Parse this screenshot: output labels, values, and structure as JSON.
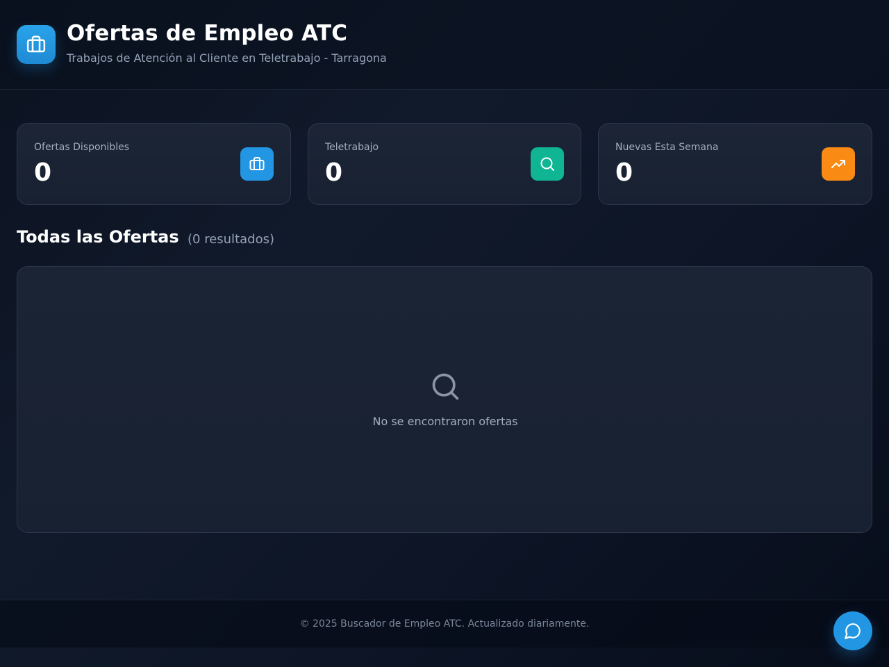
{
  "header": {
    "title": "Ofertas de Empleo ATC",
    "subtitle": "Trabajos de Atención al Cliente en Teletrabajo - Tarragona",
    "logo_icon": "briefcase-icon"
  },
  "stats": [
    {
      "label": "Ofertas Disponibles",
      "value": "0",
      "icon": "briefcase-icon",
      "color": "#2396e3"
    },
    {
      "label": "Teletrabajo",
      "value": "0",
      "icon": "search-icon",
      "color": "#10b594"
    },
    {
      "label": "Nuevas Esta Semana",
      "value": "0",
      "icon": "trending-up-icon",
      "color": "#f98a14"
    }
  ],
  "results": {
    "title": "Todas las Ofertas",
    "count_text": "(0 resultados)",
    "empty_icon": "search-icon",
    "empty_message": "No se encontraron ofertas"
  },
  "footer": {
    "text": "© 2025 Buscador de Empleo ATC. Actualizado diariamente."
  },
  "chat": {
    "icon": "chat-bubble-icon",
    "color": "#2396e3"
  }
}
